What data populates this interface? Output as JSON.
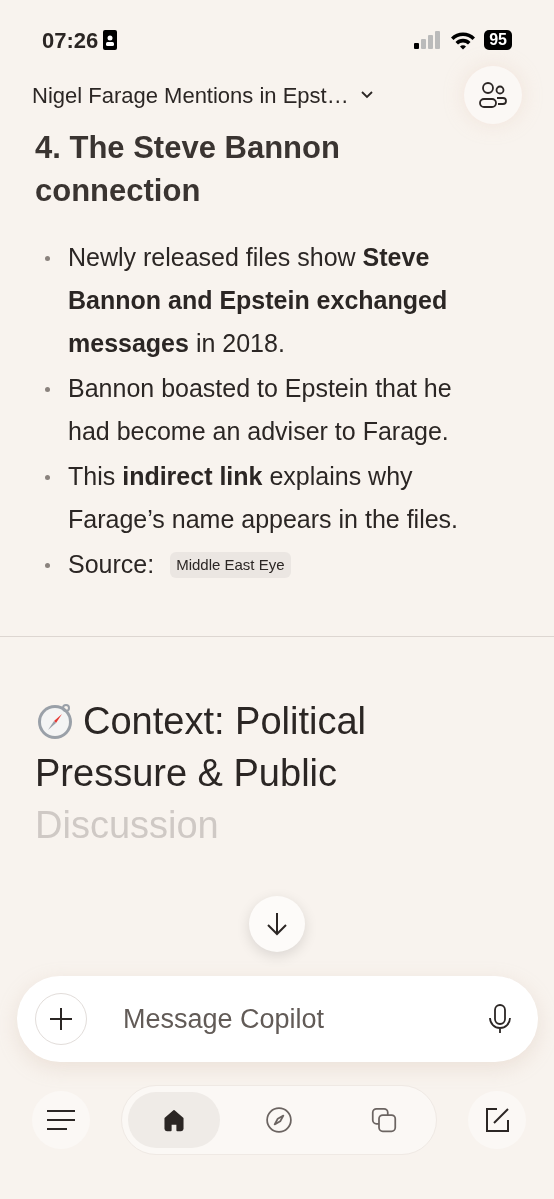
{
  "status_bar": {
    "time": "07:26",
    "battery": "95"
  },
  "header": {
    "title": "Nigel Farage Mentions in Epst…"
  },
  "section": {
    "heading": "4. The Steve Bannon connection",
    "bullets": [
      {
        "kind": "text",
        "text": "Newly released files show **Steve Bannon and Epstein exchanged messages** in 2018."
      },
      {
        "kind": "text",
        "text": "Bannon boasted to Epstein that he had become an adviser to Farage."
      },
      {
        "kind": "text",
        "text": "This **indirect link** explains why Farage’s name appears in the files."
      },
      {
        "kind": "source",
        "text": "Source:",
        "chip": "Middle East Eye"
      }
    ]
  },
  "next_section": {
    "heading_lines": [
      "Context: Political",
      "Pressure & Public",
      "Discussion"
    ]
  },
  "composer": {
    "placeholder": "Message Copilot"
  },
  "nav_tabs": [
    {
      "kind": "home",
      "selected": true
    },
    {
      "kind": "discover",
      "selected": false
    },
    {
      "kind": "pages",
      "selected": false
    }
  ]
}
